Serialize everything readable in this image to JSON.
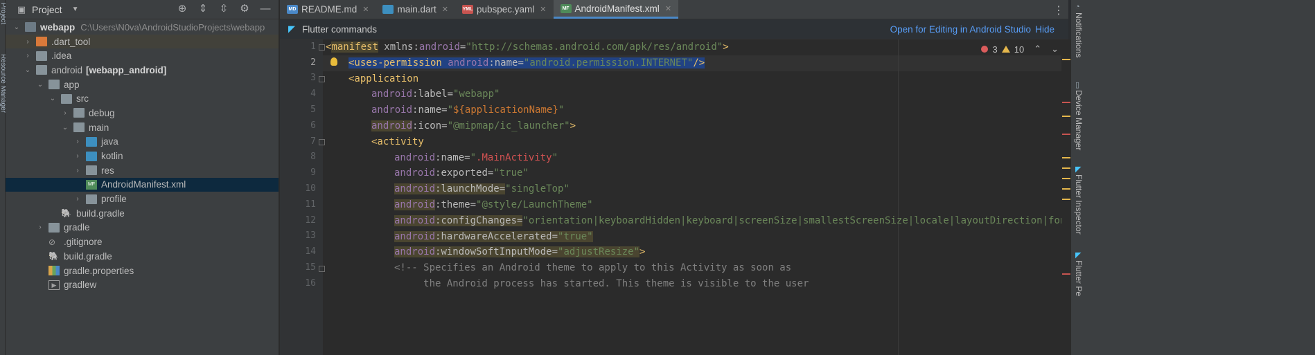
{
  "left_strip": {
    "labels": [
      "Project",
      "Resource Manager"
    ]
  },
  "project_panel": {
    "title": "Project",
    "tools": [
      "target-icon",
      "expand-all-icon",
      "collapse-all-icon",
      "gear-icon",
      "minimize-icon"
    ],
    "tree": [
      {
        "name": "webapp",
        "path": "C:\\Users\\N0va\\AndroidStudioProjects\\webapp"
      },
      {
        "name": ".dart_tool"
      },
      {
        "name": ".idea"
      },
      {
        "name": "android",
        "extra": "[webapp_android]"
      },
      {
        "name": "app"
      },
      {
        "name": "src"
      },
      {
        "name": "debug"
      },
      {
        "name": "main"
      },
      {
        "name": "java"
      },
      {
        "name": "kotlin"
      },
      {
        "name": "res"
      },
      {
        "name": "AndroidManifest.xml"
      },
      {
        "name": "profile"
      },
      {
        "name": "build.gradle"
      },
      {
        "name": "gradle"
      },
      {
        "name": ".gitignore"
      },
      {
        "name": "build.gradle"
      },
      {
        "name": "gradle.properties"
      },
      {
        "name": "gradlew"
      }
    ]
  },
  "tabs": [
    {
      "label": "README.md",
      "icon": "MD"
    },
    {
      "label": "main.dart",
      "icon": "dart"
    },
    {
      "label": "pubspec.yaml",
      "icon": "YML"
    },
    {
      "label": "AndroidManifest.xml",
      "icon": "MF"
    }
  ],
  "banner": {
    "title": "Flutter commands",
    "open_link": "Open for Editing in Android Studio",
    "hide_link": "Hide"
  },
  "inspections": {
    "errors": "3",
    "warnings": "10"
  },
  "line_numbers": [
    "1",
    "2",
    "3",
    "4",
    "5",
    "6",
    "7",
    "8",
    "9",
    "10",
    "11",
    "12",
    "13",
    "14",
    "15",
    "16"
  ],
  "code": {
    "l1": {
      "open": "<",
      "tag": "manifest",
      "ns_attr": " xmlns:",
      "ns": "android",
      "eq": "=",
      "val": "\"http://schemas.android.com/apk/res/android\"",
      "close": ">"
    },
    "l2": {
      "tag": "<uses-permission ",
      "ns": "android",
      "attr": ":name=",
      "val": "\"android.permission.INTERNET\"",
      "close": "/>"
    },
    "l3": {
      "tag": "<application"
    },
    "l4": {
      "ns": "android",
      "attr": ":label=",
      "val": "\"webapp\""
    },
    "l5": {
      "ns": "android",
      "attr": ":name=",
      "val_open": "\"",
      "tmpl": "${applicationName}",
      "val_close": "\""
    },
    "l6": {
      "ns": "android",
      "attr": ":icon=",
      "val": "\"@mipmap/ic_launcher\"",
      "close": ">"
    },
    "l7": {
      "tag": "<activity"
    },
    "l8": {
      "ns": "android",
      "attr": ":name=",
      "val_open": "\"",
      "red": ".MainActivity",
      "val_close": "\""
    },
    "l9": {
      "ns": "android",
      "attr": ":exported=",
      "val": "\"true\""
    },
    "l10": {
      "ns": "android",
      "attr": ":launchMode=",
      "val": "\"singleTop\""
    },
    "l11": {
      "ns": "android",
      "attr": ":theme=",
      "val": "\"@style/LaunchTheme\""
    },
    "l12": {
      "ns": "android",
      "attr": ":configChanges=",
      "val": "\"orientation|keyboardHidden|keyboard|screenSize|smallestScreenSize|locale|layoutDirection|fontSca"
    },
    "l13": {
      "ns": "android",
      "attr": ":hardwareAccelerated=",
      "val": "\"true\""
    },
    "l14": {
      "ns": "android",
      "attr": ":windowSoftInputMode=",
      "val": "\"adjustResize\"",
      "close": ">"
    },
    "l15": {
      "comment": "<!-- Specifies an Android theme to apply to this Activity as soon as"
    },
    "l16": {
      "comment": "     the Android process has started. This theme is visible to the user"
    }
  },
  "right_strip": {
    "labels": [
      "Notifications",
      "Device Manager",
      "Flutter Inspector",
      "Flutter Pe"
    ]
  },
  "colors": {
    "accent": "#4a88c7",
    "selection": "#214283",
    "error": "#db5c5c",
    "warning": "#e5b74c",
    "link": "#589df6"
  }
}
